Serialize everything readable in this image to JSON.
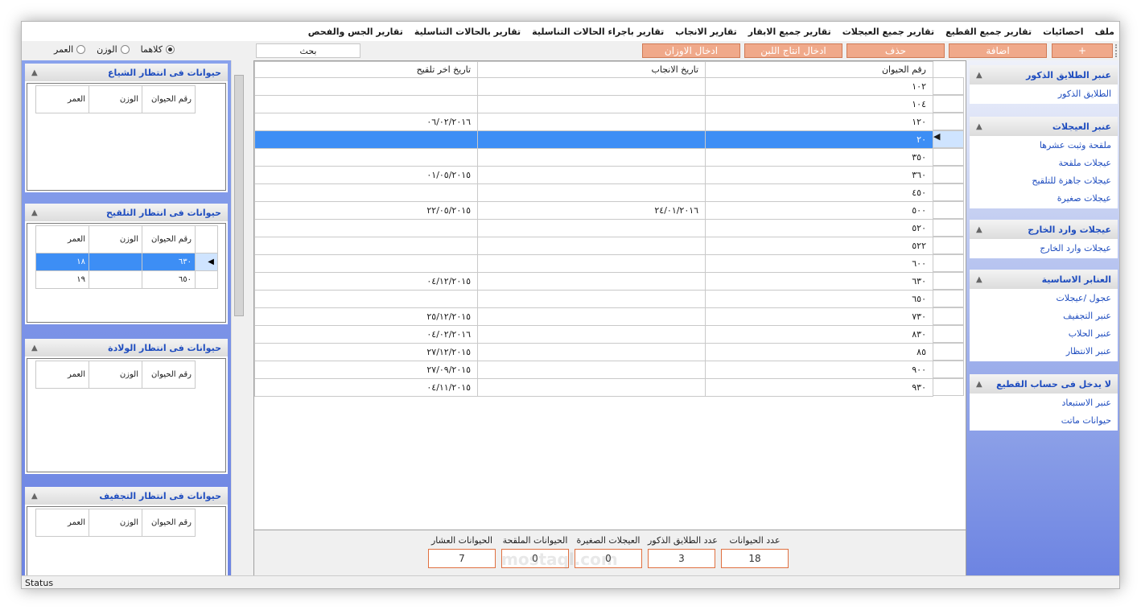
{
  "menu": [
    "ملف",
    "احصائيات",
    "تقارير جميع القطيع",
    "تقارير جميع العيجلات",
    "تقارير جميع الابقار",
    "تقارير الانجاب",
    "تقارير باجراء الحالات التناسلية",
    "تقارير بالحالات التناسلية",
    "تقارير الجس والفحص"
  ],
  "toolbar": {
    "add": "+",
    "edit": "اضافة",
    "delete": "حذف",
    "milk": "ادخال انتاج اللبن",
    "weights": "ادخال الاوزان",
    "search": "بحث",
    "radio_age": "العمر",
    "radio_weight": "الوزن",
    "radio_both": "كلاهما"
  },
  "left_panels": [
    {
      "title": "حيوانات فى انتظار الشياع",
      "cols": [
        "رقم الحيوان",
        "الوزن",
        "العمر"
      ],
      "rows": []
    },
    {
      "title": "حيوانات فى انتظار التلقيح",
      "cols": [
        "رقم الحيوان",
        "الوزن",
        "العمر"
      ],
      "rows": [
        [
          "٦٣٠",
          "",
          "١٨"
        ],
        [
          "٦٥٠",
          "",
          "١٩"
        ]
      ]
    },
    {
      "title": "حيوانات فى انتظار الولادة",
      "cols": [
        "رقم الحيوان",
        "الوزن",
        "العمر"
      ],
      "rows": []
    },
    {
      "title": "حيوانات فى انتظار التجفيف",
      "cols": [
        "رقم الحيوان",
        "الوزن",
        "العمر"
      ],
      "rows": []
    }
  ],
  "main_grid": {
    "cols": [
      "رقم الحيوان",
      "تاريخ الانجاب",
      "تاريخ اخر تلقيح"
    ],
    "rows": [
      [
        "١٠٢",
        "",
        ""
      ],
      [
        "١٠٤",
        "",
        ""
      ],
      [
        "١٢٠",
        "",
        "٠٦/٠٢/٢٠١٦"
      ],
      [
        "٢٠",
        "",
        ""
      ],
      [
        "٣٥٠",
        "",
        ""
      ],
      [
        "٣٦٠",
        "",
        "٠١/٠٥/٢٠١٥"
      ],
      [
        "٤٥٠",
        "",
        ""
      ],
      [
        "٥٠٠",
        "٢٤/٠١/٢٠١٦",
        "٢٢/٠٥/٢٠١٥"
      ],
      [
        "٥٢٠",
        "",
        ""
      ],
      [
        "٥٢٢",
        "",
        ""
      ],
      [
        "٦٠٠",
        "",
        ""
      ],
      [
        "٦٣٠",
        "",
        "٠٤/١٢/٢٠١٥"
      ],
      [
        "٦٥٠",
        "",
        ""
      ],
      [
        "٧٣٠",
        "",
        "٢٥/١٢/٢٠١٥"
      ],
      [
        "٨٣٠",
        "",
        "٠٤/٠٢/٢٠١٦"
      ],
      [
        "٨٥",
        "",
        "٢٧/١٢/٢٠١٥"
      ],
      [
        "٩٠٠",
        "",
        "٢٧/٠٩/٢٠١٥"
      ],
      [
        "٩٣٠",
        "",
        "٠٤/١١/٢٠١٥"
      ]
    ],
    "selected_row": 3
  },
  "summary": {
    "total_label": "عدد الحيوانات",
    "total": "18",
    "males_label": "عدد الطلايق الذكور",
    "males": "3",
    "young_label": "العيجلات الصغيرة",
    "young": "0",
    "inseminated_label": "الحيوانات الملقحة",
    "inseminated": "0",
    "pregnant_label": "الحيوانات العشار",
    "pregnant": "7"
  },
  "nav": [
    {
      "title": "عنبر الطلايق الذكور",
      "items": [
        "الطلايق الذكور"
      ]
    },
    {
      "title": "عنبر العيجلات",
      "items": [
        "ملقحة وثبت عشرها",
        "عيجلات ملقحة",
        "عيجلات جاهزة للتلقيح",
        "عيجلات صغيرة"
      ]
    },
    {
      "title": "عيجلات وارد الخارج",
      "items": [
        "عيجلات وارد الخارج"
      ]
    },
    {
      "title": "العنابر الاساسية",
      "items": [
        "عجول /عيجلات",
        "عنبر التجفيف",
        "عنبر الحلاب",
        "عنبر الانتظار"
      ]
    },
    {
      "title": "لا يدخل فى حساب القطيع",
      "items": [
        "عنبر الاستبعاد",
        "حيوانات ماتت"
      ]
    }
  ],
  "status": "Status",
  "watermark": "mostaql.com",
  "colors": {
    "accent": "#3d8ef5",
    "button": "#f0a98a",
    "nav_bg": "#6d84e2",
    "link": "#1f4dbf"
  }
}
